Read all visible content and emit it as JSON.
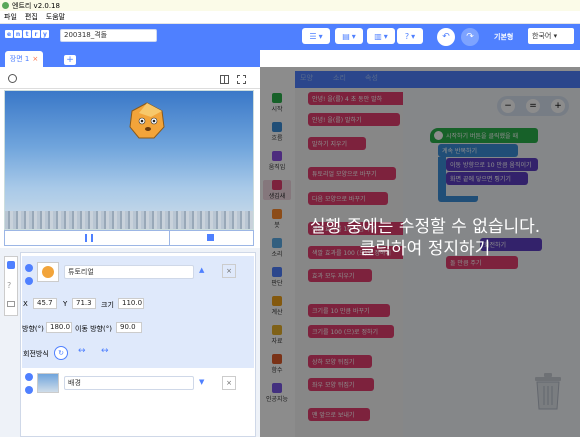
{
  "window": {
    "title": "엔트리 v2.0.18"
  },
  "menu": [
    "파일",
    "편집",
    "도움말"
  ],
  "header": {
    "logo": [
      "e",
      "n",
      "t",
      "r",
      "y"
    ],
    "project_name": "200318_격돌",
    "mode": "기본형",
    "language": "한국어"
  },
  "scene": {
    "tab": "장면 1",
    "add": "+"
  },
  "objects": [
    {
      "name": "튜토리얼",
      "x": "45.7",
      "y": "71.3",
      "size": "110.0",
      "direction": "180.0",
      "move_direction": "90.0"
    },
    {
      "name": "배경"
    }
  ],
  "labels": {
    "x": "X",
    "y": "Y",
    "size": "크기",
    "direction": "방향(°)",
    "move_direction": "이동 방향(°)",
    "rotation": "회전방식"
  },
  "block_tabs": [
    "블록",
    "모양",
    "소리",
    "속성"
  ],
  "categories": [
    {
      "name": "시작",
      "color": "#2ab14b"
    },
    {
      "name": "흐름",
      "color": "#3b8fd9"
    },
    {
      "name": "움직임",
      "color": "#8c4fe6"
    },
    {
      "name": "생김새",
      "color": "#e43f6f"
    },
    {
      "name": "붓",
      "color": "#ff8b2c"
    },
    {
      "name": "소리",
      "color": "#5daee8"
    },
    {
      "name": "판단",
      "color": "#4f80ff"
    },
    {
      "name": "계산",
      "color": "#f0a21b"
    },
    {
      "name": "자료",
      "color": "#e8b12a"
    },
    {
      "name": "함수",
      "color": "#de5c2b"
    },
    {
      "name": "인공지능",
      "color": "#7a58e8"
    }
  ],
  "palette_blocks": [
    "안녕! 을(를) 4 초 동안 말하",
    "안녕! 을(를) 말하기",
    "말하기 지우기",
    "튜토리얼 모양으로 바꾸기",
    "다음 모양으로 바꾸기",
    "색깔 효과를 10 만큼 주기",
    "색깔 효과를 100 (으)로 정하기",
    "효과 모두 지우기",
    "크기를 10 만큼 바꾸기",
    "크기를 100 (으)로 정하기",
    "상하 모양 뒤집기",
    "좌우 모양 뒤집기",
    "맨 앞으로 보내기"
  ],
  "workspace_blocks": [
    "시작하기 버튼을 클릭했을 때",
    "계속 반복하기",
    "이동 방향으로 10 만큼 움직이기",
    "화면 끝에 닿으면 튕기기",
    "회전하기",
    "돌 만큼 주기"
  ],
  "overlay": {
    "line1": "실행 중에는 수정할 수 없습니다.",
    "line2": "클릭하여 정지하기"
  },
  "colors": {
    "accent": "#4f80ff",
    "looks": "#e43f6f",
    "motion": "#5d3ec4"
  }
}
